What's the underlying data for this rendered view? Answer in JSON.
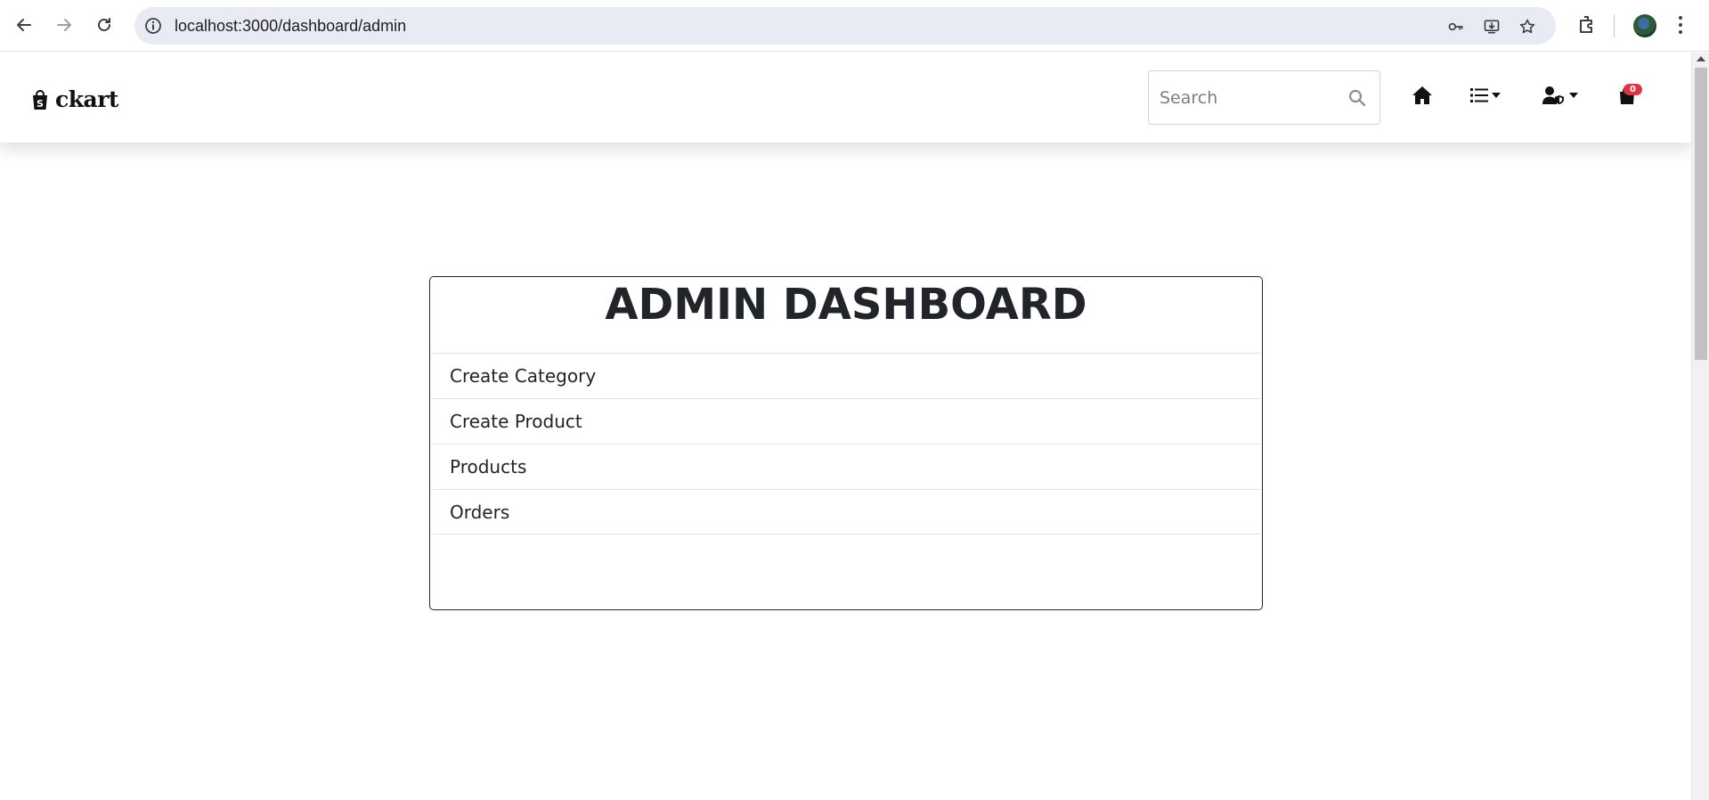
{
  "browser": {
    "url": "localhost:3000/dashboard/admin"
  },
  "header": {
    "brand": "ckart",
    "search_placeholder": "Search",
    "cart_count": "0"
  },
  "dashboard": {
    "title": "ADMIN DASHBOARD",
    "items": [
      {
        "label": "Create Category"
      },
      {
        "label": "Create Product"
      },
      {
        "label": "Products"
      },
      {
        "label": "Orders"
      }
    ]
  },
  "colors": {
    "badge": "#dc3545",
    "text": "#212529",
    "omnibox": "#e9ebf4"
  }
}
